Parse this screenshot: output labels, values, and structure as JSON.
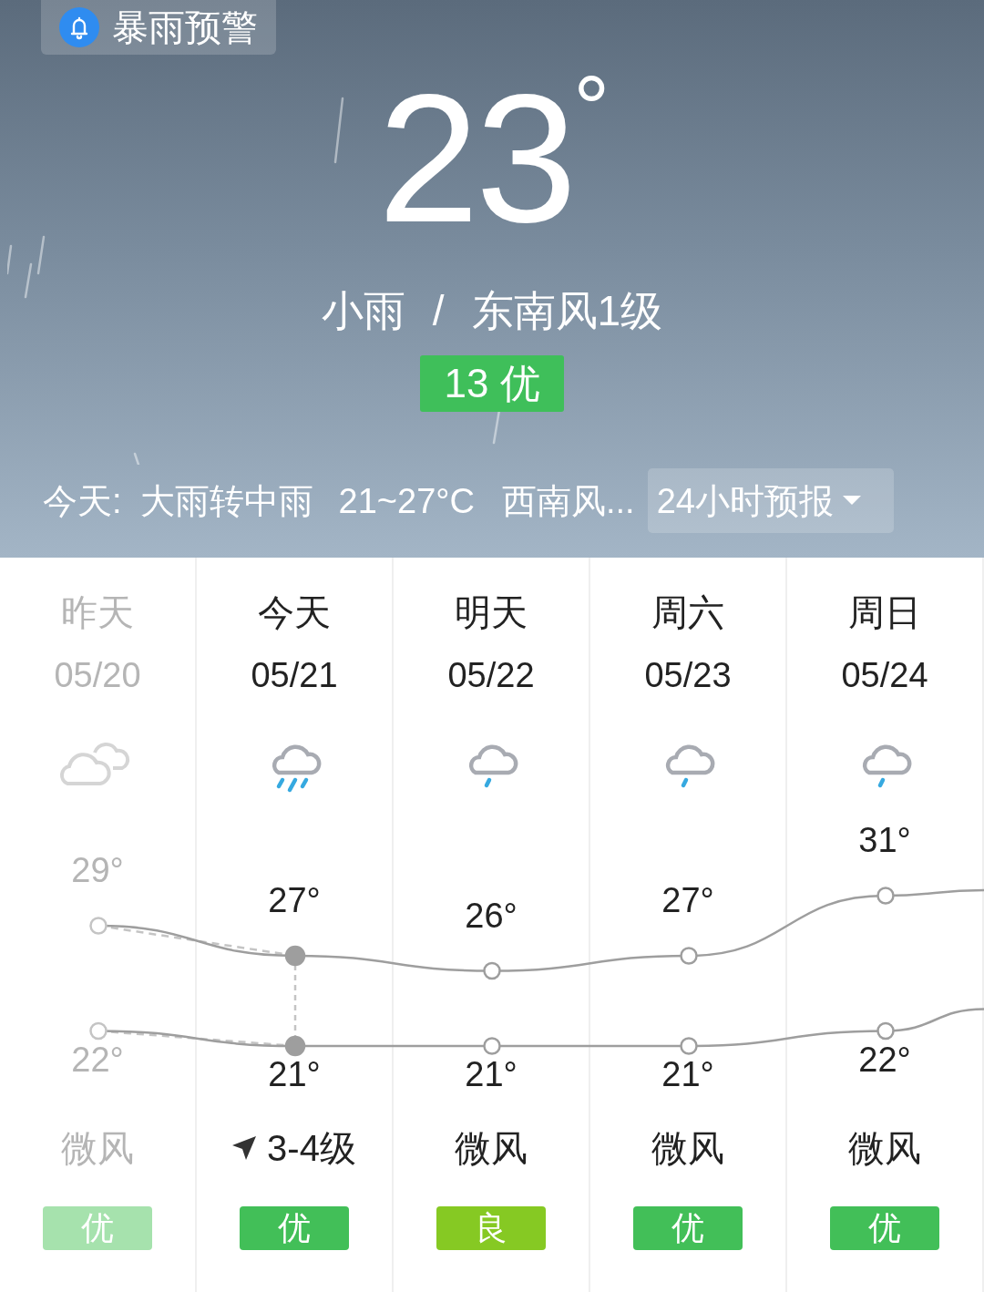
{
  "alert": {
    "text": "暴雨预警"
  },
  "current": {
    "temperature": "23$^{°}$",
    "condition": "小雨",
    "separator": "/",
    "wind": "东南风1级",
    "aqi": "13 优"
  },
  "today": {
    "label": "今天:",
    "weather": "大雨转中雨",
    "range": "21~27°C",
    "wind": "西南风...",
    "forecast_button": "24小时预报"
  },
  "days": [
    {
      "kind": "past",
      "name": "昨天",
      "date": "05/20",
      "high": "29°",
      "low": "22°",
      "wind": "微风",
      "wind_arrow": false,
      "aqi": "优",
      "color": "#a6e2ad"
    },
    {
      "kind": "today",
      "name": "今天",
      "date": "05/21",
      "high": "27°",
      "low": "21°",
      "wind": "3-4级",
      "wind_arrow": true,
      "aqi": "优",
      "color": "#42bf58"
    },
    {
      "kind": "future",
      "name": "明天",
      "date": "05/22",
      "high": "26°",
      "low": "21°",
      "wind": "微风",
      "wind_arrow": false,
      "aqi": "良",
      "color": "#86c923"
    },
    {
      "kind": "future",
      "name": "周六",
      "date": "05/23",
      "high": "27°",
      "low": "21°",
      "wind": "微风",
      "wind_arrow": false,
      "aqi": "优",
      "color": "#42bf58"
    },
    {
      "kind": "future",
      "name": "周日",
      "date": "05/24",
      "high": "31°",
      "low": "22°",
      "wind": "微风",
      "wind_arrow": false,
      "aqi": "优",
      "color": "#42bf58"
    }
  ]
}
